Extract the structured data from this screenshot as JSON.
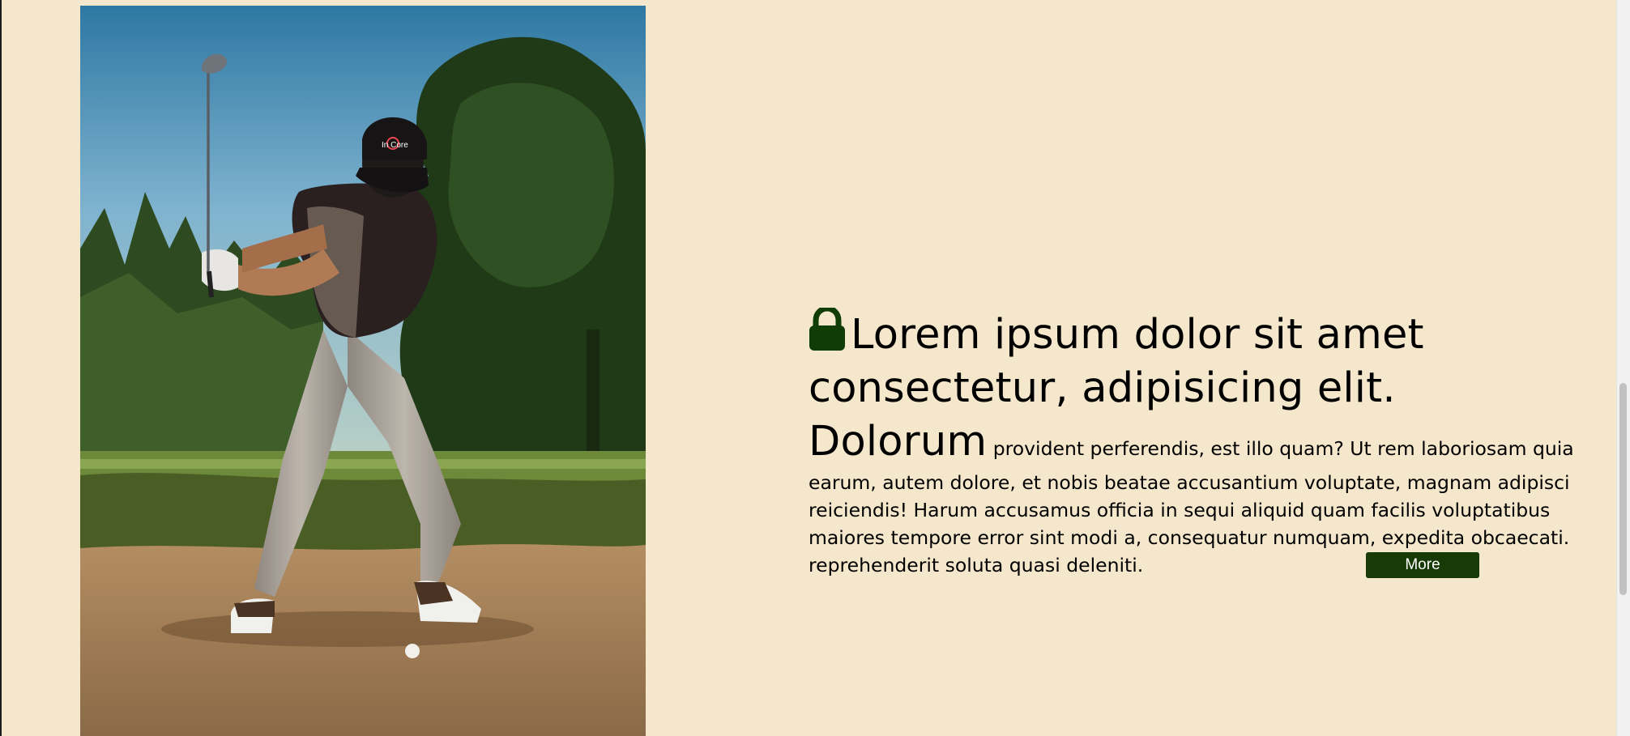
{
  "hero": {
    "photo_subject": "golfer-swinging-in-sand-bunker",
    "cap_logo_text": "In Core"
  },
  "feature": {
    "icon": "lock-icon",
    "icon_color": "#0f3d05",
    "heading": "Lorem ipsum dolor sit amet consectetur, adipisicing elit. Dolorum",
    "body": "provident perferendis, est illo quam? Ut rem laboriosam quia earum, autem dolore, et nobis beatae accusantium voluptate, magnam adipisci reiciendis! Harum accusamus officia in sequi aliquid quam facilis voluptatibus maiores tempore error sint modi a, consequatur numquam, expedita obcaecati. reprehenderit soluta quasi deleniti.",
    "more_label": "More",
    "button_color": "#173a06"
  },
  "theme": {
    "background": "#f5e7cc"
  }
}
